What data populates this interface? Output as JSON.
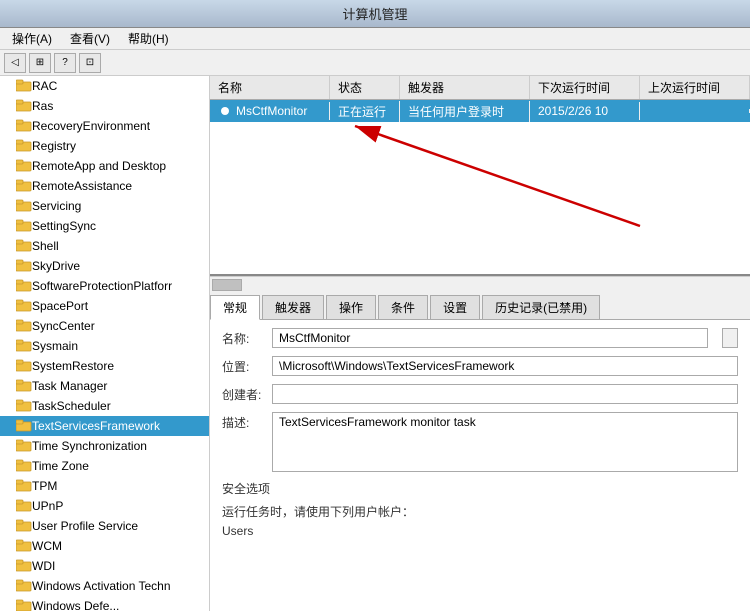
{
  "titleBar": {
    "title": "计算机管理"
  },
  "menuBar": {
    "items": [
      {
        "id": "action",
        "label": "操作(A)"
      },
      {
        "id": "view",
        "label": "查看(V)"
      },
      {
        "id": "help",
        "label": "帮助(H)"
      }
    ]
  },
  "toolbar": {
    "buttons": [
      {
        "id": "btn1",
        "icon": "◁",
        "label": "back"
      },
      {
        "id": "btn2",
        "icon": "⊞",
        "label": "grid"
      },
      {
        "id": "btn3",
        "icon": "?",
        "label": "help"
      },
      {
        "id": "btn4",
        "icon": "⊡",
        "label": "view"
      }
    ]
  },
  "leftPanel": {
    "items": [
      "RAC",
      "Ras",
      "RecoveryEnvironment",
      "Registry",
      "RemoteApp and Desktop",
      "RemoteAssistance",
      "Servicing",
      "SettingSync",
      "Shell",
      "SkyDrive",
      "SoftwareProtectionPlatforr",
      "SpacePort",
      "SyncCenter",
      "Sysmain",
      "SystemRestore",
      "Task Manager",
      "TaskScheduler",
      "TextServicesFramework",
      "Time Synchronization",
      "Time Zone",
      "TPM",
      "UPnP",
      "User Profile Service",
      "WCM",
      "WDI",
      "Windows Activation Techn",
      "Windows Defe..."
    ],
    "selectedItem": "TextServicesFramework"
  },
  "tableHeader": {
    "columns": [
      {
        "id": "name",
        "label": "名称"
      },
      {
        "id": "status",
        "label": "状态"
      },
      {
        "id": "trigger",
        "label": "触发器"
      },
      {
        "id": "next",
        "label": "下次运行时间"
      },
      {
        "id": "last",
        "label": "上次运行时间"
      }
    ]
  },
  "tableRows": [
    {
      "name": "MsCtfMonitor",
      "status": "正在运行",
      "trigger": "当任何用户登录时",
      "next": "2015/2/26 10",
      "last": "",
      "selected": true
    }
  ],
  "tabs": [
    {
      "id": "general",
      "label": "常规",
      "active": true
    },
    {
      "id": "trigger",
      "label": "触发器"
    },
    {
      "id": "action",
      "label": "操作"
    },
    {
      "id": "condition",
      "label": "条件"
    },
    {
      "id": "settings",
      "label": "设置"
    },
    {
      "id": "history",
      "label": "历史记录(已禁用)"
    }
  ],
  "detailForm": {
    "nameLabel": "名称:",
    "nameValue": "MsCtfMonitor",
    "locationLabel": "位置:",
    "locationValue": "\\Microsoft\\Windows\\TextServicesFramework",
    "creatorLabel": "创建者:",
    "creatorValue": "",
    "descLabel": "描述:",
    "descValue": "TextServicesFramework monitor task",
    "securityLabel": "安全选项",
    "runAsLabel": "运行任务时，请使用下列用户帐户：",
    "usersLabel": "Users"
  },
  "colors": {
    "selectedBg": "#3399cc",
    "accent": "#cc0000"
  }
}
